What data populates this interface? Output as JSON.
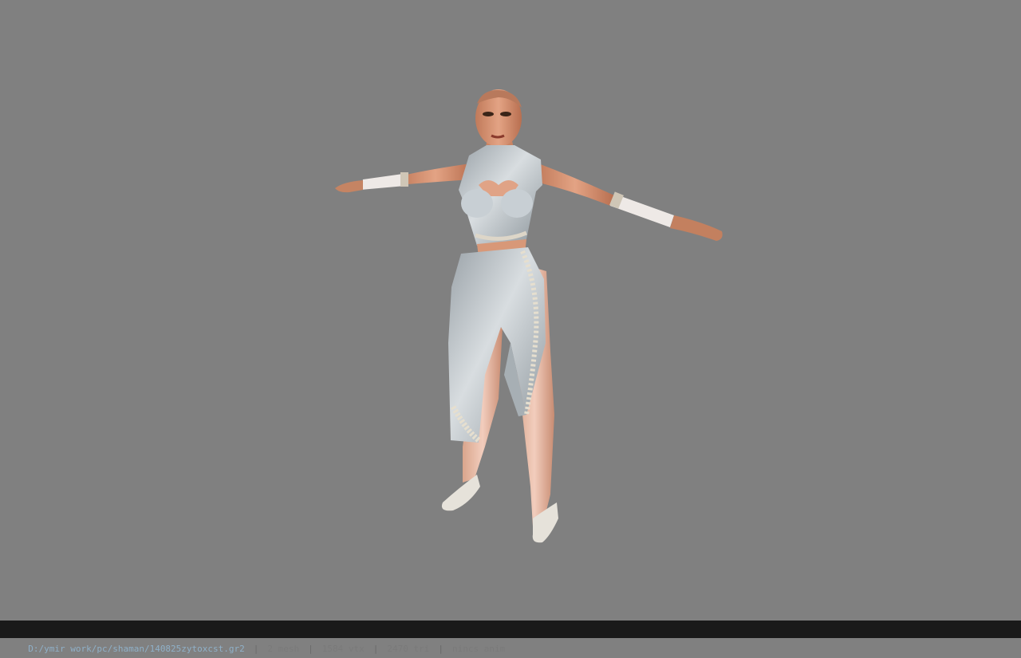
{
  "viewport": {
    "background": "#808080",
    "model_name": "female-character-t-pose"
  },
  "statusbar": {
    "file_path": "D:/ymir work/pc/shaman/140825zytoxcst.gr2",
    "mesh": "2 mesh",
    "vtx": "1584 vtx",
    "tri": "2470 tri",
    "anim": "nincs anim",
    "separator": "|"
  }
}
